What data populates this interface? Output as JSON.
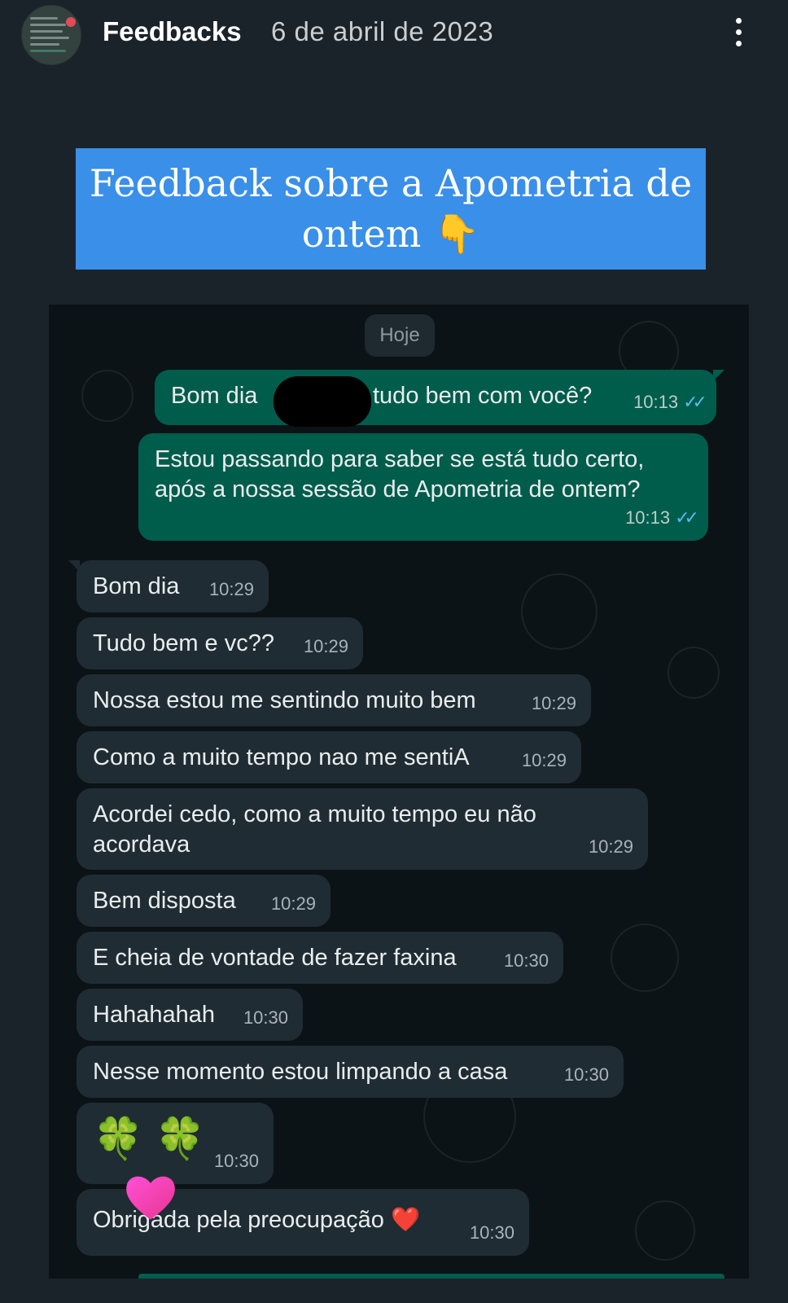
{
  "story": {
    "title": "Feedbacks",
    "date": "6 de abril de 2023",
    "menu_icon": "more-vertical-icon"
  },
  "banner": {
    "line1": "Feedback sobre a Apometria de",
    "line2": "ontem",
    "emoji": "👇"
  },
  "chat": {
    "day_label": "Hoje",
    "messages": [
      {
        "dir": "out",
        "text_a": "Bom dia",
        "text_b": "tudo bem com você?",
        "time": "10:13",
        "ticks": "✓✓"
      },
      {
        "dir": "out",
        "text": "Estou passando para saber se está tudo certo, após a nossa sessão de Apometria de ontem?",
        "time": "10:13",
        "ticks": "✓✓"
      },
      {
        "dir": "in",
        "text": "Bom dia",
        "time": "10:29"
      },
      {
        "dir": "in",
        "text": "Tudo bem e vc??",
        "time": "10:29"
      },
      {
        "dir": "in",
        "text": "Nossa estou me sentindo muito bem",
        "time": "10:29"
      },
      {
        "dir": "in",
        "text": "Como a muito tempo nao me sentiA",
        "time": "10:29"
      },
      {
        "dir": "in",
        "text": "Acordei cedo, como a muito tempo eu não acordava",
        "time": "10:29"
      },
      {
        "dir": "in",
        "text": "Bem disposta",
        "time": "10:29"
      },
      {
        "dir": "in",
        "text": "E cheia de vontade de fazer faxina",
        "time": "10:30"
      },
      {
        "dir": "in",
        "text": "Hahahahah",
        "time": "10:30"
      },
      {
        "dir": "in",
        "text": "Nesse momento estou limpando a casa",
        "time": "10:30"
      },
      {
        "dir": "in",
        "text": "🍀 🍀",
        "time": "10:30"
      },
      {
        "dir": "in",
        "text": "Obrigada pela preocupação ❤️",
        "time": "10:30"
      }
    ]
  },
  "colors": {
    "background": "#1b232a",
    "banner": "#3a8fe8",
    "outgoing_bubble": "#005c4b",
    "incoming_bubble": "#202c33",
    "read_ticks": "#53bdeb",
    "sticker_heart": "#f04fb4"
  }
}
